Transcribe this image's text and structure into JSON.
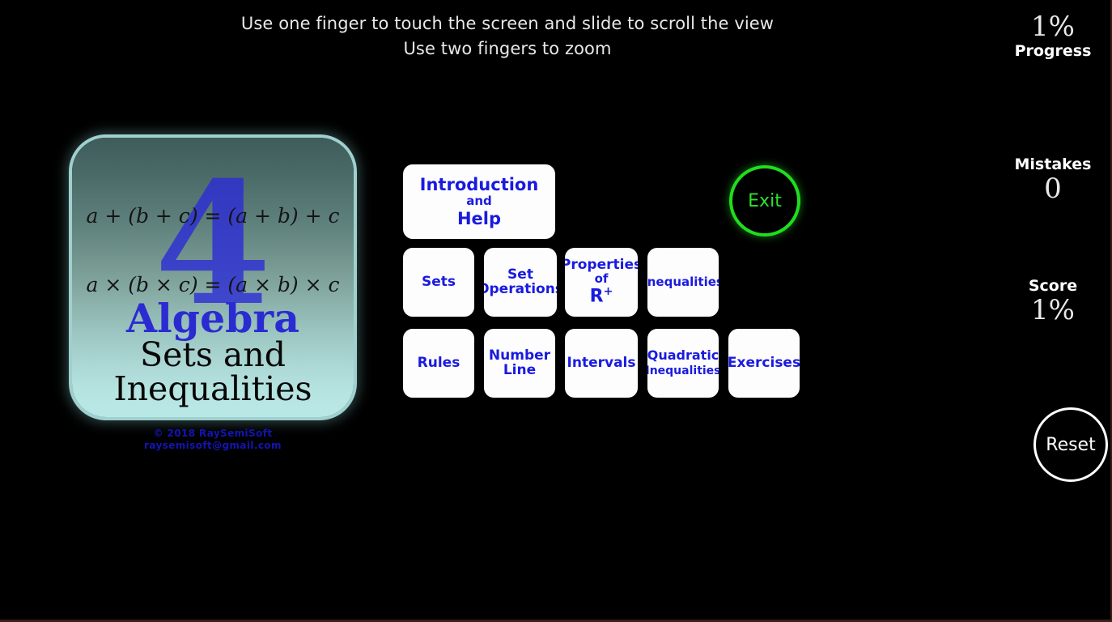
{
  "instructions": {
    "line1": "Use one finger to touch the screen and slide to scroll the view",
    "line2": "Use two fingers to zoom"
  },
  "stats": {
    "progress": {
      "label": "Progress",
      "value": "1%"
    },
    "mistakes": {
      "label": "Mistakes",
      "value": "0"
    },
    "score": {
      "label": "Score",
      "value": "1%"
    }
  },
  "reset": {
    "label": "Reset"
  },
  "exit": {
    "label": "Exit"
  },
  "title_card": {
    "chapter_number": "4",
    "formula_1": "a + (b + c) = (a + b) + c",
    "formula_2": "a × (b × c) = (a × b) × c",
    "subject": "Algebra",
    "title_line_1": "Sets and",
    "title_line_2": "Inequalities"
  },
  "copyright": {
    "line1": "© 2018 RaySemiSoft",
    "line2": "raysemisoft@gmail.com"
  },
  "menu": {
    "intro": {
      "line1": "Introduction",
      "line2": "and",
      "line3": "Help"
    },
    "row2": [
      {
        "id": "sets",
        "line1": "Sets"
      },
      {
        "id": "set-operations",
        "line1": "Set",
        "line2": "Operations"
      },
      {
        "id": "properties-r-plus",
        "line1": "Properties",
        "line2": "of",
        "line3": "R",
        "sup": "+"
      },
      {
        "id": "inequalities",
        "line1": "Inequalities"
      }
    ],
    "row3": [
      {
        "id": "rules",
        "line1": "Rules"
      },
      {
        "id": "number-line",
        "line1": "Number",
        "line2": "Line"
      },
      {
        "id": "intervals",
        "line1": "Intervals"
      },
      {
        "id": "quadratic-inequalities",
        "line1": "Quadratic",
        "line2": "Inequalities"
      },
      {
        "id": "exercises",
        "line1": "Exercises"
      }
    ]
  },
  "colors": {
    "background": "#000000",
    "button_text": "#1a1ae0",
    "button_face": "#fdfdfd",
    "exit_green": "#1fdd1f",
    "card_top": "#3e5c5a",
    "card_bottom": "#b9e9e7",
    "copyright_blue": "#1414b4"
  }
}
